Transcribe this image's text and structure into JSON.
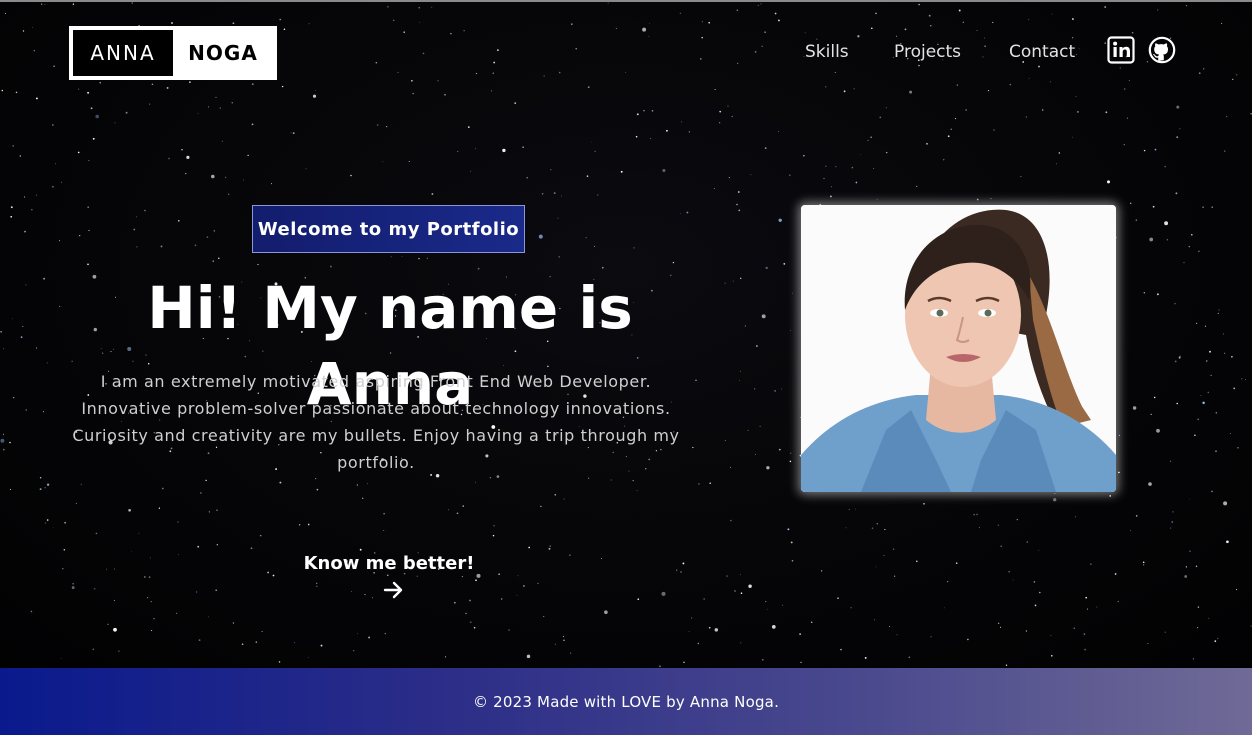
{
  "logo": {
    "first": "ANNA",
    "last": "NOGA"
  },
  "nav": {
    "items": [
      {
        "label": "Skills"
      },
      {
        "label": "Projects"
      },
      {
        "label": "Contact"
      }
    ],
    "social": [
      {
        "icon": "linkedin-icon"
      },
      {
        "icon": "github-icon"
      }
    ]
  },
  "hero": {
    "badge": "Welcome to my Portfolio",
    "title": "Hi! My name is Anna",
    "description": "I am an extremely motivated aspiring Front End Web Developer. Innovative problem-solver passionate about technology innovations. Curiosity and creativity are my bullets. Enjoy having a trip through my portfolio.",
    "cta_label": "Know me better!",
    "cta_icon": "arrow-right-icon",
    "portrait_icon": "profile-photo"
  },
  "footer": {
    "text": "© 2023 Made with LOVE by Anna Noga."
  },
  "colors": {
    "background": "#050505",
    "badge": "#1a2a8a",
    "footer_start": "#0a1a8c",
    "footer_end": "#6f6a96",
    "text": "#ffffff"
  }
}
